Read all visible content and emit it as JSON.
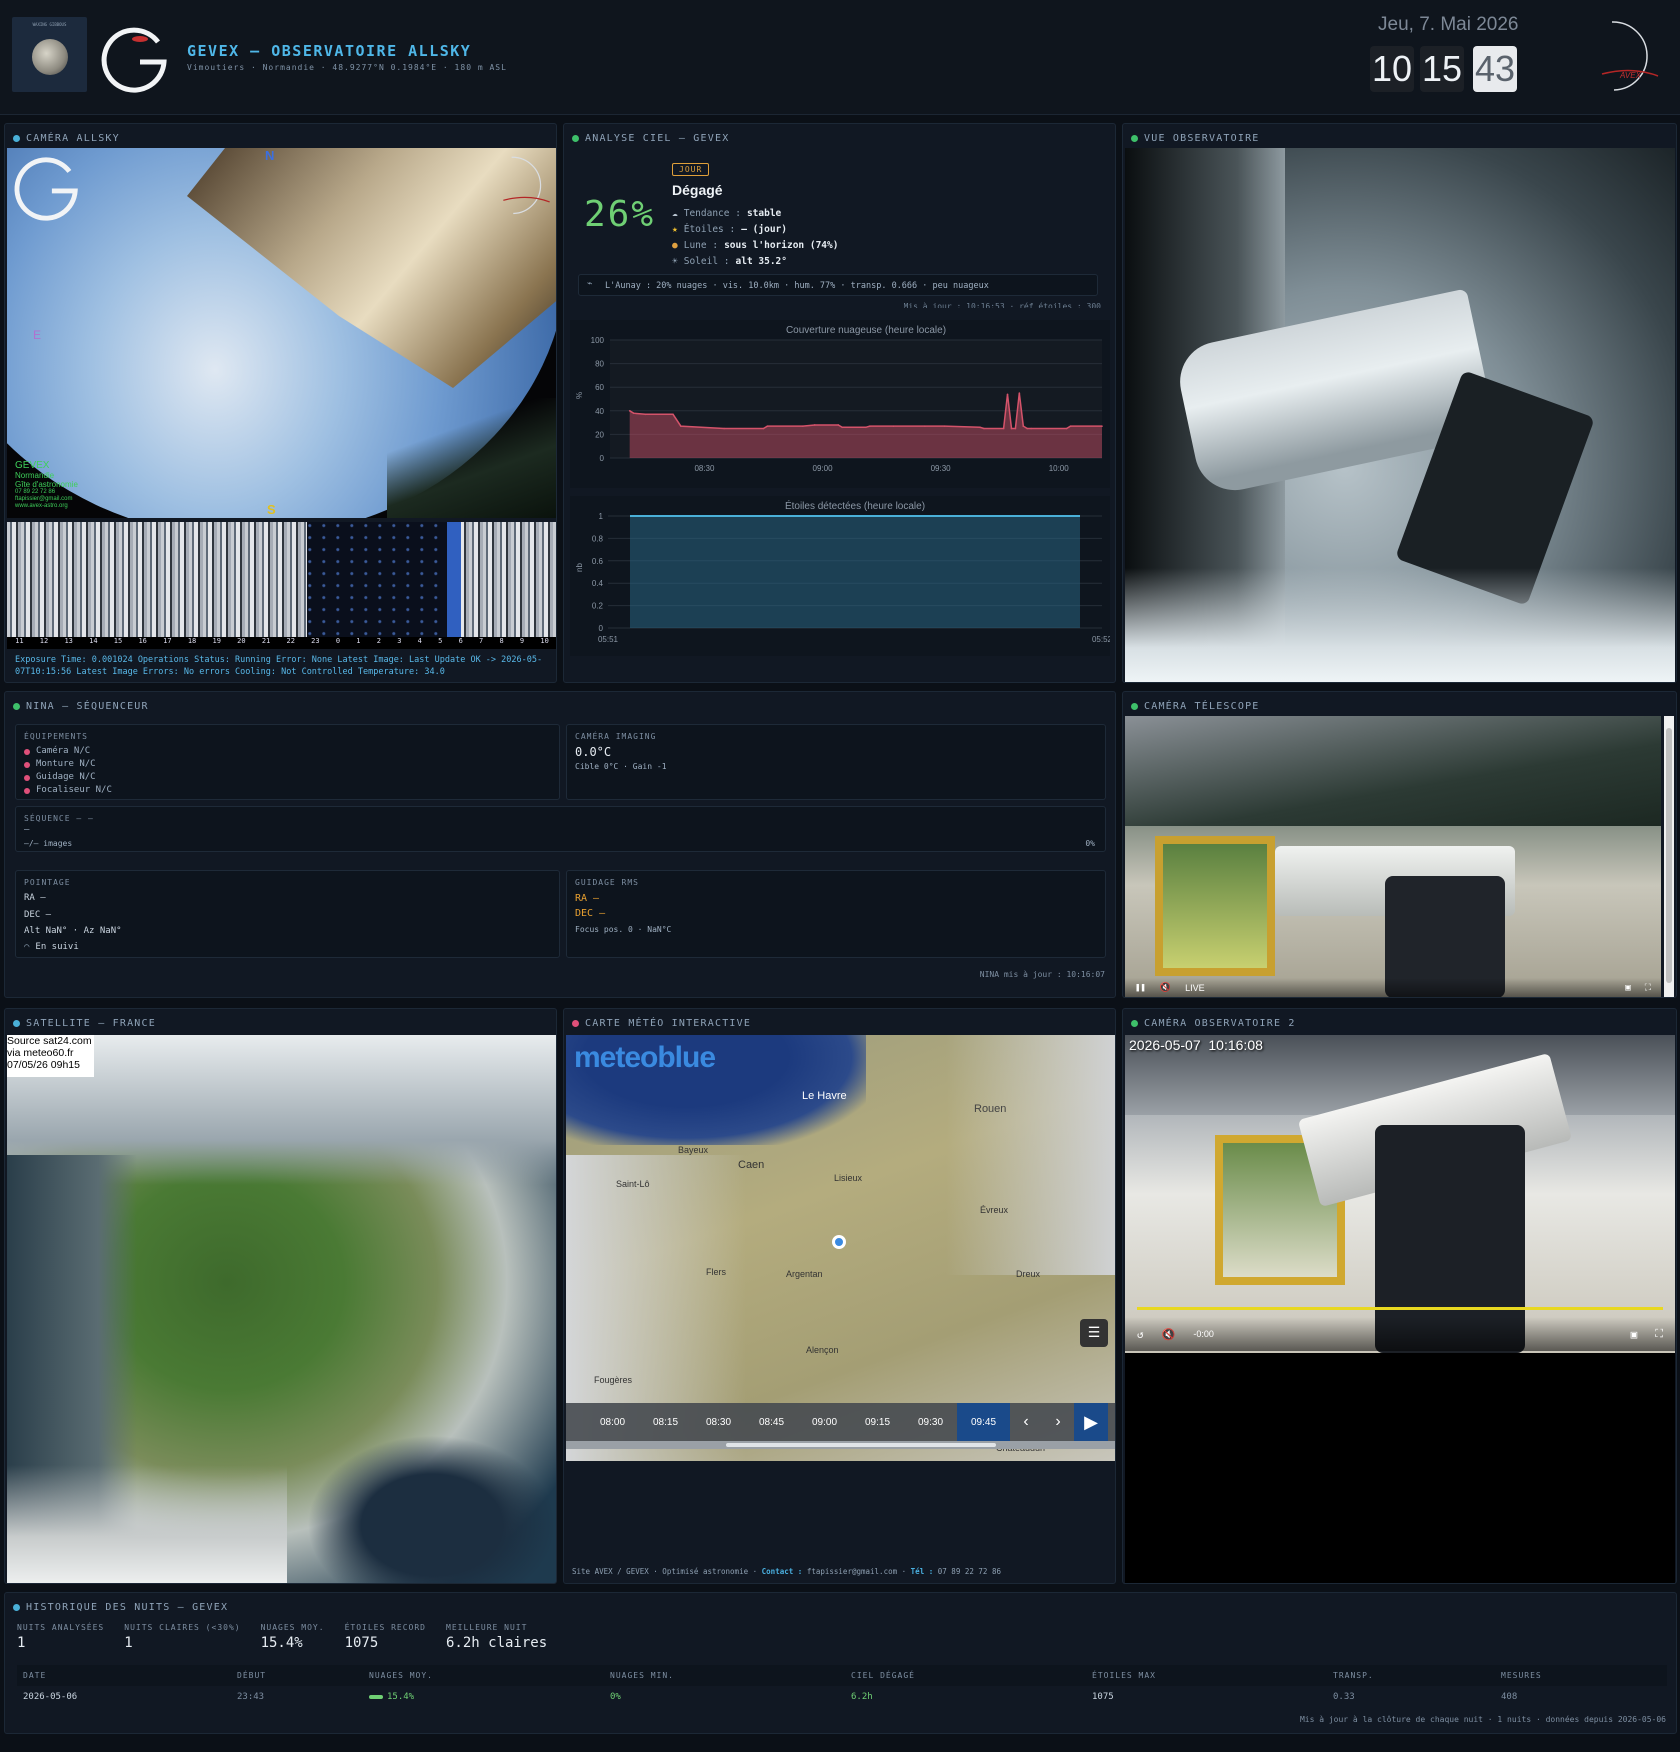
{
  "header": {
    "title": "GEVEX — OBSERVATOIRE ALLSKY",
    "subtitle": "Vimoutiers · Normandie · 48.9277°N 0.1984°E · 180 m ASL",
    "moon_label": "WAXING GIBBOUS",
    "date": "Jeu, 7. Mai 2026",
    "time": {
      "hours": "10",
      "minutes": "15",
      "seconds": "43"
    },
    "logo_text": "AVEX"
  },
  "allsky": {
    "title": "CAMÉRA ALLSKY",
    "compass": {
      "n": "N",
      "s": "S",
      "e": "E"
    },
    "overlay_left": [
      "GEVEX",
      "Normandie",
      "Gîte d'astronomie",
      "07 89 22 72 86",
      "ftapissier@gmail.com",
      "www.avex-astro.org"
    ],
    "keogram_hours": [
      "11",
      "12",
      "13",
      "14",
      "15",
      "16",
      "17",
      "18",
      "19",
      "20",
      "21",
      "22",
      "23",
      "0",
      "1",
      "2",
      "3",
      "4",
      "5",
      "6",
      "7",
      "8",
      "9",
      "10"
    ],
    "status_line": "Exposure Time: 0.001024 Operations Status: Running Error: None Latest Image: Last Update OK -> 2026-05-07T10:15:56 Latest Image Errors: No errors Cooling: Not Controlled Temperature: 34.0"
  },
  "sky": {
    "title": "ANALYSE CIEL — GEVEX",
    "percent": "26%",
    "badge": "JOUR",
    "condition": "Dégagé",
    "details": [
      {
        "icon": "cloud-icon",
        "label": "Tendance :",
        "value": "stable"
      },
      {
        "icon": "star-icon",
        "label": "Étoiles :",
        "value": "— (jour)"
      },
      {
        "icon": "moon-icon",
        "label": "Lune :",
        "value": "sous l'horizon (74%)"
      },
      {
        "icon": "sun-icon",
        "label": "Soleil :",
        "value": "alt 35.2°"
      }
    ],
    "weather_line": "L'Aunay : 20% nuages · vis. 10.0km · hum. 77% · transp. 0.666 · peu nuageux",
    "update_line": "Mis à jour : 10:16:53 · réf étoiles : 300",
    "colors": {
      "percent": "#6fcf74",
      "badge": "#e0a03a",
      "cloud_line": "#d4536a",
      "stars_line": "#4ab0d8"
    }
  },
  "chart_data": [
    {
      "type": "area",
      "title": "Couverture nuageuse (heure locale)",
      "ylabel": "%",
      "xlabel": "",
      "ylim": [
        0,
        100
      ],
      "yticks": [
        0,
        20,
        40,
        60,
        80,
        100
      ],
      "xticks": [
        "08:30",
        "09:00",
        "09:30",
        "10:00"
      ],
      "xlim": [
        "08:06",
        "10:11"
      ],
      "x": [
        "08:11",
        "08:12",
        "08:15",
        "08:22",
        "08:24",
        "08:35",
        "08:45",
        "08:46",
        "08:55",
        "08:58",
        "09:04",
        "09:05",
        "09:11",
        "09:12",
        "09:18",
        "09:26",
        "09:31",
        "09:40",
        "09:41",
        "09:46",
        "09:47",
        "09:48",
        "09:49",
        "09:50",
        "09:51",
        "09:52",
        "09:53",
        "10:02",
        "10:03",
        "10:11"
      ],
      "series": [
        {
          "values": [
            40,
            38,
            37,
            37,
            27,
            25,
            25,
            27,
            27,
            28,
            28,
            26,
            26,
            27,
            27,
            27,
            27,
            26,
            25,
            25,
            54,
            25,
            25,
            55,
            27,
            25,
            25,
            25,
            27,
            27
          ]
        }
      ]
    },
    {
      "type": "area",
      "title": "Étoiles détectées (heure locale)",
      "ylabel": "nb",
      "xlabel": "",
      "ylim": [
        0,
        1.0
      ],
      "yticks": [
        0.0,
        0.2,
        0.4,
        0.6,
        0.8,
        1.0
      ],
      "xticks": [
        "05:51",
        "05:52"
      ],
      "series": [
        {
          "values": [
            1.0,
            1.0
          ]
        }
      ]
    }
  ],
  "observatory": {
    "title": "VUE OBSERVATOIRE"
  },
  "nina": {
    "title": "NINA — SÉQUENCEUR",
    "equipment_label": "ÉQUIPEMENTS",
    "equipment": [
      "Caméra N/C",
      "Monture N/C",
      "Guidage N/C",
      "Focaliseur N/C"
    ],
    "camera_label": "CAMÉRA IMAGING",
    "camera_temp": "0.0°C",
    "camera_info": "Cible 0°C · Gain -1",
    "sequence_label": "SÉQUENCE — —",
    "sequence_value": "—",
    "sequence_images": "—/— images",
    "sequence_percent": "0%",
    "pointing_label": "POINTAGE",
    "ra": "RA  —",
    "dec": "DEC —",
    "altaz": "Alt NaN° · Az NaN°",
    "tracking": "En suivi",
    "guiding_label": "GUIDAGE RMS",
    "guide_ra": "RA  —",
    "guide_dec": "DEC —",
    "focus": "Focus pos. 0 · NaN°C",
    "updated": "NINA mis à jour : 10:16:07"
  },
  "telescope": {
    "title": "CAMÉRA TÉLESCOPE",
    "live": "LIVE"
  },
  "satellite": {
    "title": "SATELLITE — FRANCE",
    "source_lines": [
      "Source sat24.com",
      "via meteo60.fr",
      "07/05/26 09h15"
    ]
  },
  "meteo": {
    "title": "CARTE MÉTÉO INTERACTIVE",
    "brand": "meteoblue",
    "cities": [
      "Le Havre",
      "Rouen",
      "Bayeux",
      "Caen",
      "Lisieux",
      "Saint-Lô",
      "Évreux",
      "Flers",
      "Argentan",
      "Dreux",
      "Alençon",
      "Fougères",
      "Châteaudun"
    ],
    "times": [
      "08:00",
      "08:15",
      "08:30",
      "08:45",
      "09:00",
      "09:15",
      "09:30",
      "09:45"
    ],
    "active_time": "09:45",
    "footer_site": "Site AVEX / GEVEX · Optimisé astronomie ·",
    "footer_contact_label": "Contact :",
    "footer_contact": "ftapissier@gmail.com",
    "footer_tel_label": "Tél :",
    "footer_tel": "07 89 22 72 86"
  },
  "obs2": {
    "title": "CAMÉRA OBSERVATOIRE 2",
    "timestamp": "2026-05-07  10:16:08",
    "time_label": "-0:00"
  },
  "history": {
    "title": "HISTORIQUE DES NUITS — GEVEX",
    "stats": [
      {
        "label": "NUITS ANALYSÉES",
        "value": "1"
      },
      {
        "label": "NUITS CLAIRES (<30%)",
        "value": "1"
      },
      {
        "label": "NUAGES MOY.",
        "value": "15.4%"
      },
      {
        "label": "ÉTOILES RECORD",
        "value": "1075"
      },
      {
        "label": "MEILLEURE NUIT",
        "value": "6.2h claires"
      }
    ],
    "columns": [
      "DATE",
      "DÉBUT",
      "NUAGES MOY.",
      "NUAGES MIN.",
      "CIEL DÉGAGÉ",
      "ÉTOILES MAX",
      "TRANSP.",
      "MESURES"
    ],
    "rows": [
      {
        "date": "2026-05-06",
        "start": "23:43",
        "cloud_avg": "15.4%",
        "cloud_min": "0%",
        "clear": "6.2h",
        "stars_max": "1075",
        "transp": "0.33",
        "measures": "408"
      }
    ],
    "footer": "Mis à jour à la clôture de chaque nuit · 1 nuits · données depuis 2026-05-06"
  }
}
